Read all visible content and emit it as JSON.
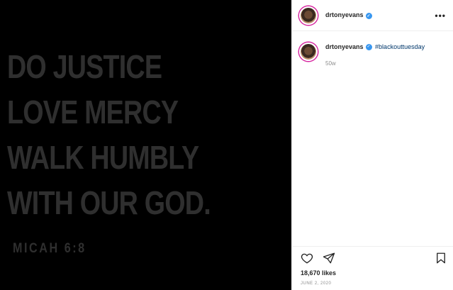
{
  "media": {
    "quote_lines": [
      "DO JUSTICE",
      "LOVE MERCY",
      "WALK HUMBLY",
      "WITH OUR GOD."
    ],
    "reference": "MICAH 6:8"
  },
  "header": {
    "username": "drtonyevans",
    "more_label": "•••"
  },
  "caption": {
    "username": "drtonyevans",
    "hashtag": "#blackouttuesday",
    "time": "50w"
  },
  "footer": {
    "likes": "18,670 likes",
    "date": "JUNE 2, 2020"
  },
  "icons": {
    "like": "heart-icon",
    "share": "paper-plane-icon",
    "save": "bookmark-icon",
    "verified": "verified-badge-icon",
    "more": "more-options-icon"
  },
  "colors": {
    "verified": "#3897f0",
    "hashtag": "#00376b",
    "quote_text": "#2f2f2f"
  }
}
